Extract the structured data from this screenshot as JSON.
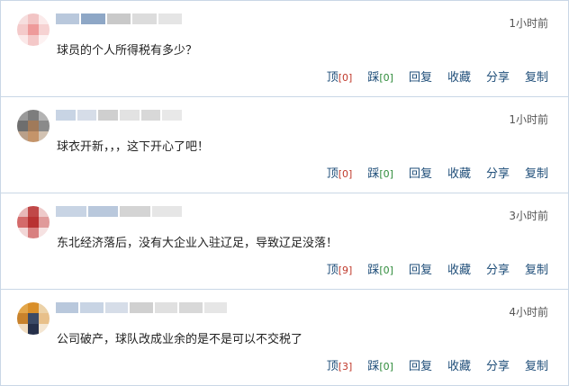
{
  "comments": [
    {
      "time": "1小时前",
      "text": "球员的个人所得税有多少？",
      "up_label": "顶",
      "up_count": "[0]",
      "down_label": "踩",
      "down_count": "[0]",
      "reply": "回复",
      "fav": "收藏",
      "share": "分享",
      "copy": "复制"
    },
    {
      "time": "1小时前",
      "text": "球衣开新，，，这下开心了吧！",
      "up_label": "顶",
      "up_count": "[0]",
      "down_label": "踩",
      "down_count": "[0]",
      "reply": "回复",
      "fav": "收藏",
      "share": "分享",
      "copy": "复制"
    },
    {
      "time": "3小时前",
      "text": "东北经济落后，没有大企业入驻辽足，导致辽足没落！",
      "up_label": "顶",
      "up_count": "[9]",
      "down_label": "踩",
      "down_count": "[0]",
      "reply": "回复",
      "fav": "收藏",
      "share": "分享",
      "copy": "复制"
    },
    {
      "time": "4小时前",
      "text": "公司破产，球队改成业余的是不是可以不交税了",
      "up_label": "顶",
      "up_count": "[3]",
      "down_label": "踩",
      "down_count": "[0]",
      "reply": "回复",
      "fav": "收藏",
      "share": "分享",
      "copy": "复制"
    }
  ],
  "colors": {
    "border": "#c9d7e6",
    "action_link": "#1f4e79",
    "up_count": "#c0392b",
    "down_count": "#2e8b3a"
  }
}
